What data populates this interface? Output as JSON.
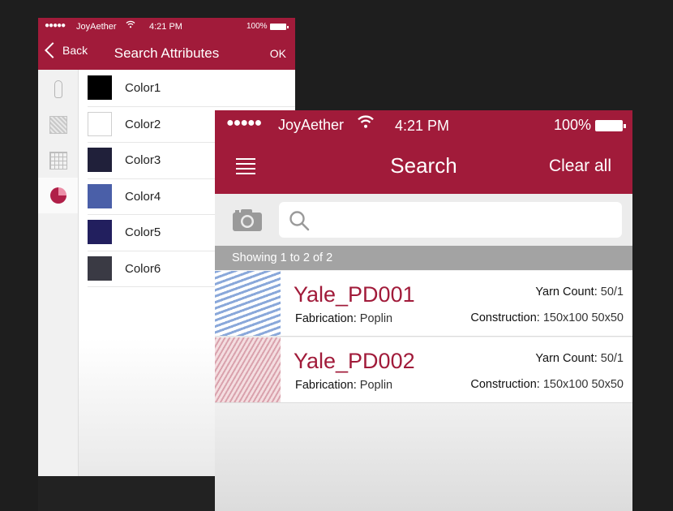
{
  "attributes_screen": {
    "status": {
      "dots": "●●●●●",
      "carrier": "JoyAether",
      "time": "4:21 PM",
      "battery": "100%"
    },
    "back_label": "Back",
    "title": "Search Attributes",
    "ok_label": "OK",
    "side_icons": [
      "thread-icon",
      "fabric-texture-icon",
      "grid-icon",
      "color-pie-icon"
    ],
    "colors": [
      {
        "label": "Color1",
        "hex": "#000000"
      },
      {
        "label": "Color2",
        "hex": "#ffffff"
      },
      {
        "label": "Color3",
        "hex": "#20203a"
      },
      {
        "label": "Color4",
        "hex": "#4a5fa8"
      },
      {
        "label": "Color5",
        "hex": "#221f5e"
      },
      {
        "label": "Color6",
        "hex": "#3a3a44"
      }
    ]
  },
  "search_screen": {
    "status": {
      "dots": "●●●●●",
      "carrier": "JoyAether",
      "time": "4:21 PM",
      "battery": "100%"
    },
    "title": "Search",
    "clear_label": "Clear all",
    "search_placeholder": "",
    "result_count": "Showing 1 to 2 of 2",
    "results": [
      {
        "name": "Yale_PD001",
        "fabrication_label": "Fabrication:",
        "fabrication": "Poplin",
        "yarn_label": "Yarn Count:",
        "yarn_count": "50/1",
        "construction_label": "Construction:",
        "construction": "150x100 50x50"
      },
      {
        "name": "Yale_PD002",
        "fabrication_label": "Fabrication:",
        "fabrication": "Poplin",
        "yarn_label": "Yarn Count:",
        "yarn_count": "50/1",
        "construction_label": "Construction:",
        "construction": "150x100 50x50"
      }
    ]
  },
  "colors": {
    "brand": "#a11b3a",
    "background": "#1e1e1e",
    "result_bar": "#a3a3a3"
  }
}
